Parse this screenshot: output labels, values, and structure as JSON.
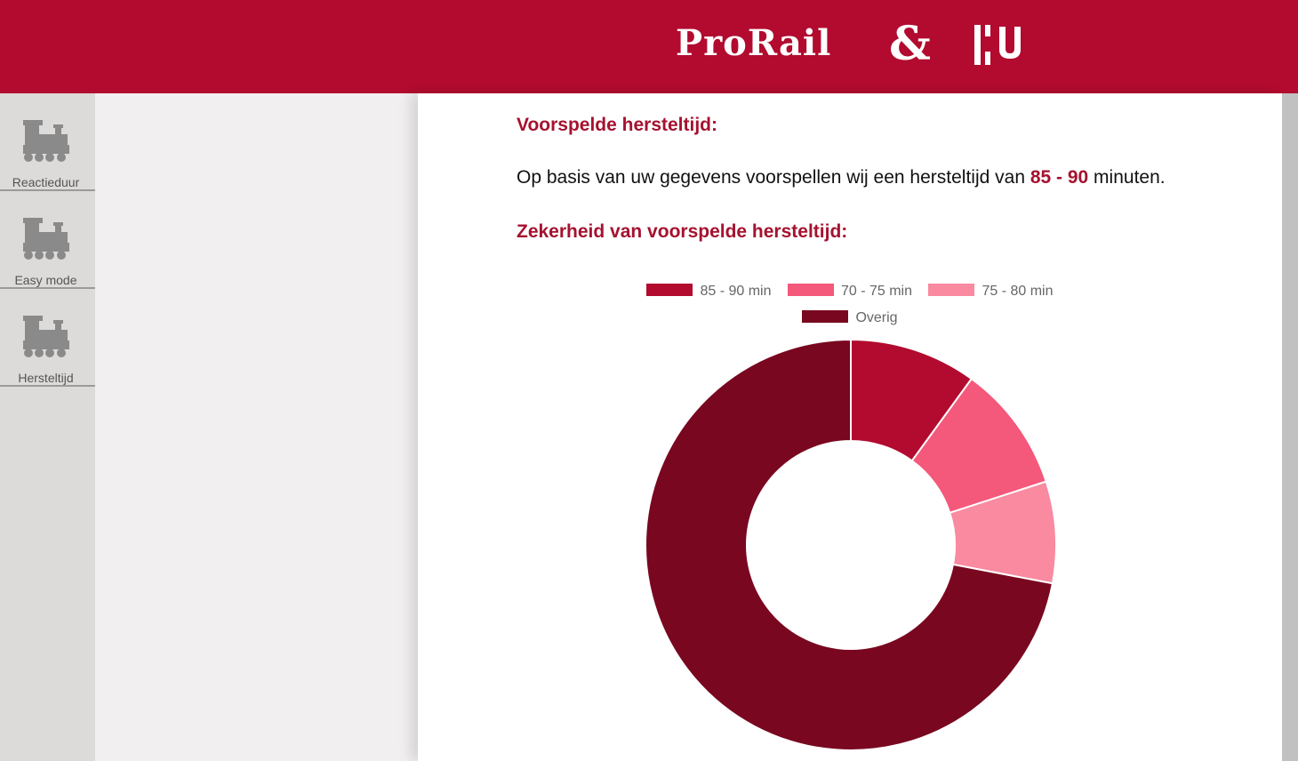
{
  "header": {
    "logo_prorail": "ProRail",
    "logo_amp": "&",
    "logo_hu": "HU"
  },
  "sidebar": {
    "items": [
      {
        "label": "Reactieduur",
        "icon": "train-icon"
      },
      {
        "label": "Easy mode",
        "icon": "train-icon"
      },
      {
        "label": "Hersteltijd",
        "icon": "train-icon"
      }
    ]
  },
  "main": {
    "heading1": "Voorspelde hersteltijd:",
    "para_before": "Op basis van uw gegevens voorspellen wij een hersteltijd van ",
    "para_highlight": "85 - 90",
    "para_after": " minuten.",
    "heading2": "Zekerheid van voorspelde hersteltijd:"
  },
  "colors": {
    "brand": "#b20b2f",
    "heading": "#a5122f",
    "slice_85_90": "#b20b2f",
    "slice_70_75": "#f4587a",
    "slice_75_80": "#f98aa0",
    "slice_overig": "#790720"
  },
  "chart_data": {
    "type": "pie",
    "variant": "doughnut",
    "legend_position": "top",
    "categories": [
      "85 - 90 min",
      "70 - 75 min",
      "75 - 80 min",
      "Overig"
    ],
    "values": [
      10,
      10,
      8,
      72
    ],
    "colors": [
      "#b20b2f",
      "#f4587a",
      "#f98aa0",
      "#790720"
    ]
  }
}
